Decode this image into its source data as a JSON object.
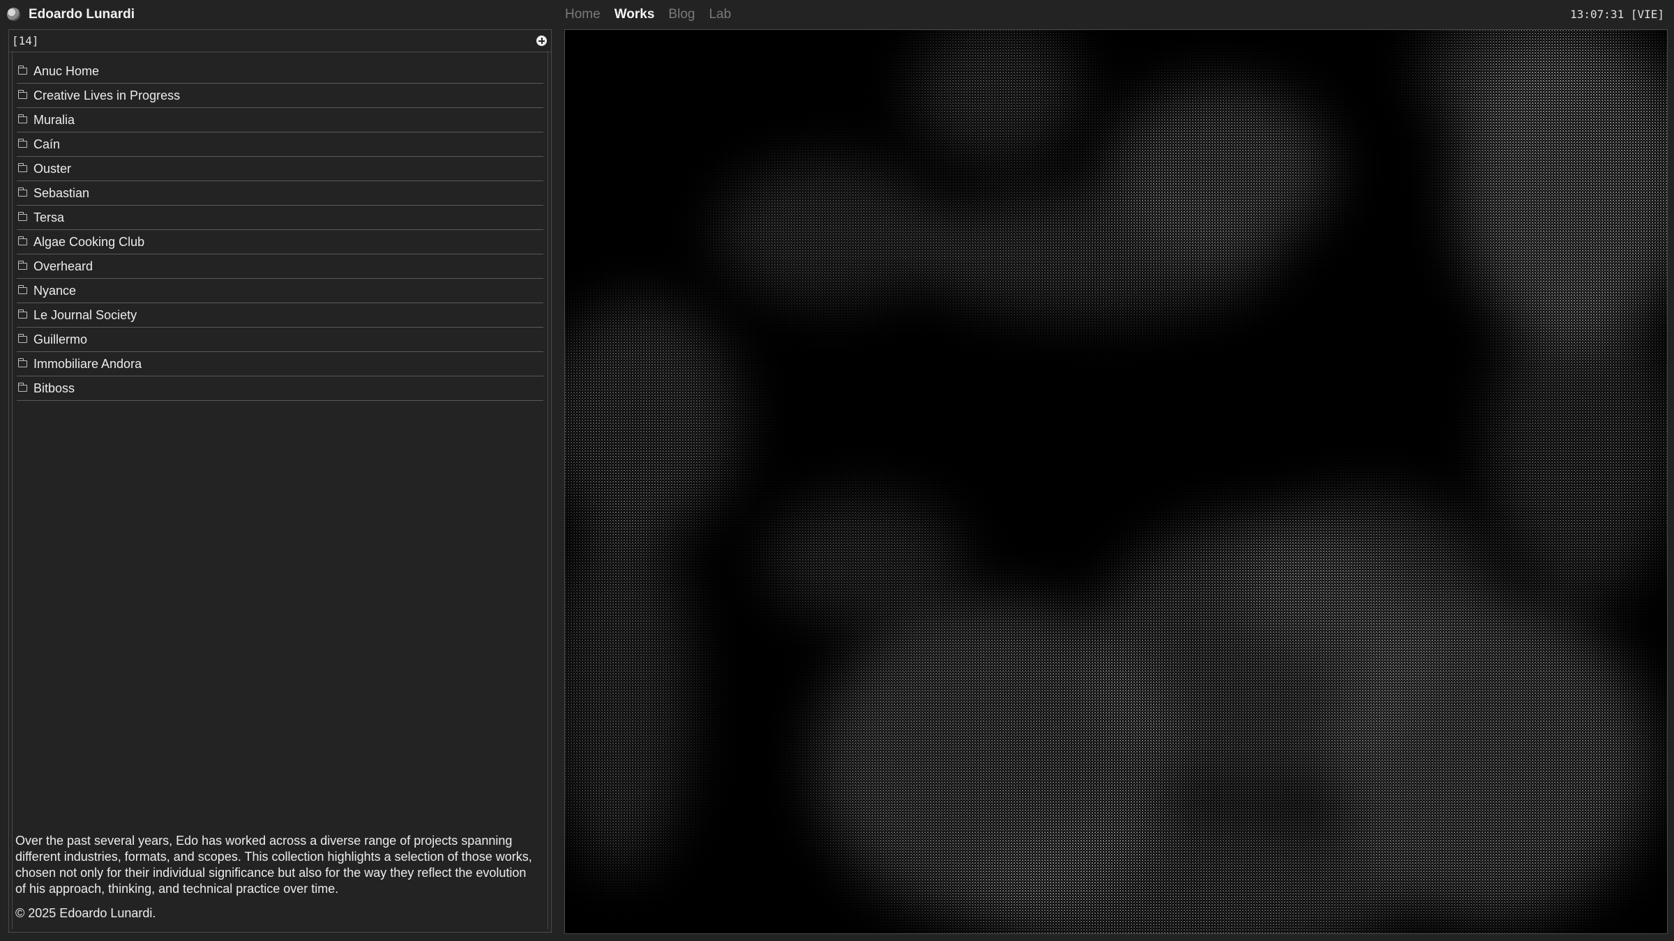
{
  "header": {
    "brand_name": "Edoardo Lunardi",
    "nav": [
      {
        "label": "Home",
        "active": false
      },
      {
        "label": "Works",
        "active": true
      },
      {
        "label": "Blog",
        "active": false
      },
      {
        "label": "Lab",
        "active": false
      }
    ],
    "clock": "13:07:31 [VIE]"
  },
  "sidebar": {
    "count": "[14]",
    "items": [
      {
        "label": "Anuc Home"
      },
      {
        "label": "Creative Lives in Progress"
      },
      {
        "label": "Muralia"
      },
      {
        "label": "Caín"
      },
      {
        "label": "Ouster"
      },
      {
        "label": "Sebastian"
      },
      {
        "label": "Tersa"
      },
      {
        "label": "Algae Cooking Club"
      },
      {
        "label": "Overheard"
      },
      {
        "label": "Nyance"
      },
      {
        "label": "Le Journal Society"
      },
      {
        "label": "Guillermo"
      },
      {
        "label": "Immobiliare Andora"
      },
      {
        "label": "Bitboss"
      }
    ],
    "description": "Over the past several years, Edo has worked across a diverse range of projects spanning different industries, formats, and scopes. This collection highlights a selection of those works, chosen not only for their individual significance but also for the way they reflect the evolution of his approach, thinking, and technical practice over time.",
    "copyright": "© 2025 Edoardo Lunardi."
  },
  "colors": {
    "background": "#232323",
    "viewer_background": "#000000",
    "dot": "#9a9a9a",
    "active_nav": "#f5f5f5",
    "inactive_nav": "#7a7a7a"
  }
}
